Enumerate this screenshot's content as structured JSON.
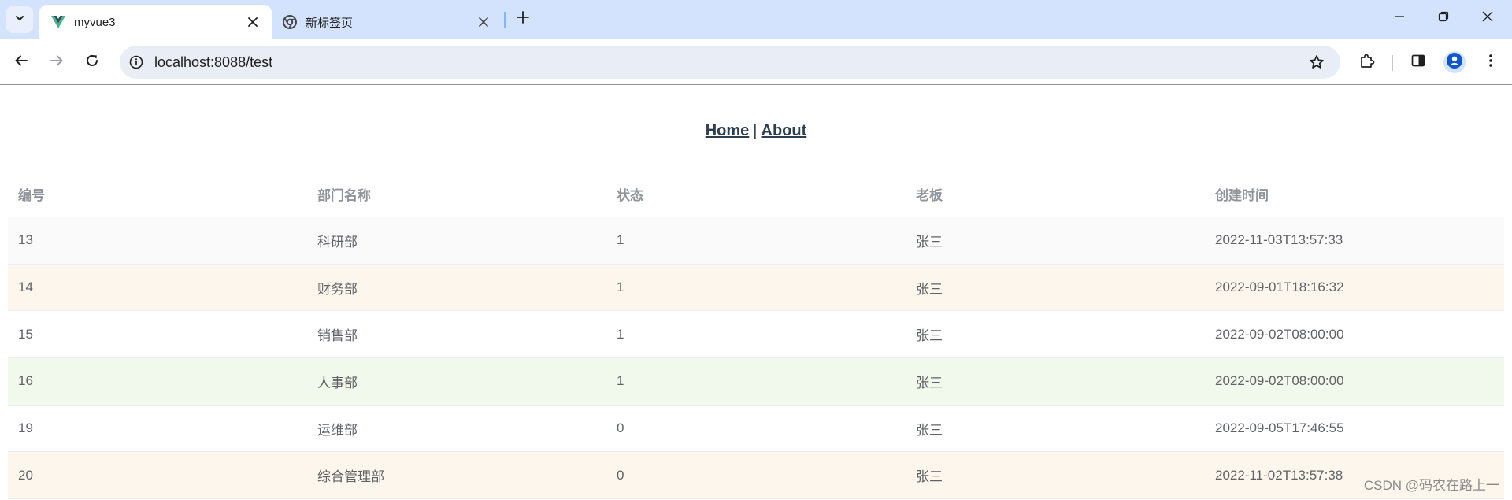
{
  "browser": {
    "tabs": [
      {
        "title": "myvue3",
        "active": true,
        "icon": "vue-logo-icon"
      },
      {
        "title": "新标签页",
        "active": false,
        "icon": "chrome-icon"
      }
    ],
    "url": "localhost:8088/test"
  },
  "nav": {
    "home": "Home",
    "separator": "|",
    "about": "About"
  },
  "table": {
    "headers": [
      "编号",
      "部门名称",
      "状态",
      "老板",
      "创建时间"
    ],
    "rows": [
      {
        "id": "13",
        "name": "科研部",
        "status": "1",
        "boss": "张三",
        "created": "2022-11-03T13:57:33",
        "style": "odd"
      },
      {
        "id": "14",
        "name": "财务部",
        "status": "1",
        "boss": "张三",
        "created": "2022-09-01T18:16:32",
        "style": "warning"
      },
      {
        "id": "15",
        "name": "销售部",
        "status": "1",
        "boss": "张三",
        "created": "2022-09-02T08:00:00",
        "style": "plain"
      },
      {
        "id": "16",
        "name": "人事部",
        "status": "1",
        "boss": "张三",
        "created": "2022-09-02T08:00:00",
        "style": "success"
      },
      {
        "id": "19",
        "name": "运维部",
        "status": "0",
        "boss": "张三",
        "created": "2022-09-05T17:46:55",
        "style": "plain"
      },
      {
        "id": "20",
        "name": "综合管理部",
        "status": "0",
        "boss": "张三",
        "created": "2022-11-02T13:57:38",
        "style": "warning"
      }
    ]
  },
  "watermark": "CSDN @码农在路上一",
  "colors": {
    "titlebar": "#d3e3fd",
    "vue_green": "#41b883",
    "vue_dark": "#35495e",
    "row_warning": "#fdf6ec",
    "row_success": "#f0f9eb",
    "row_odd": "#fafafa"
  }
}
